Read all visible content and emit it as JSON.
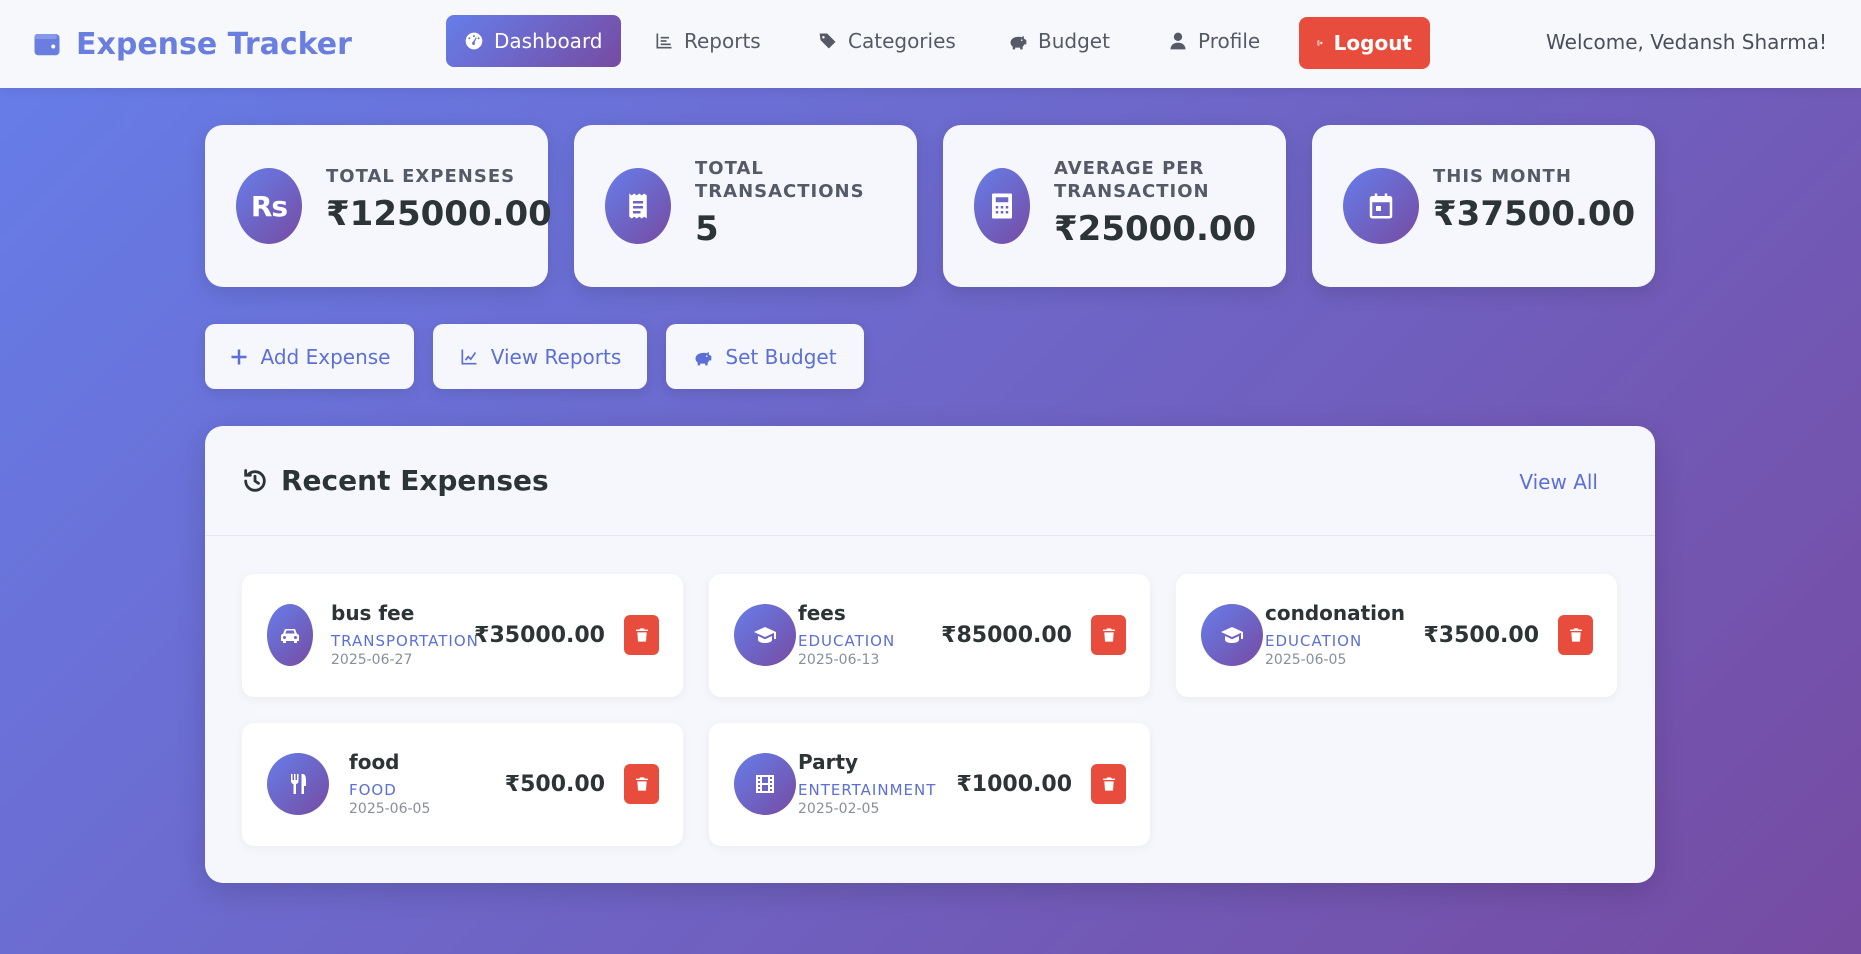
{
  "brand": {
    "title": "Expense Tracker",
    "icon": "wallet-icon"
  },
  "nav": {
    "items": [
      {
        "label": "Dashboard",
        "icon": "gauge-icon",
        "active": true
      },
      {
        "label": "Reports",
        "icon": "bar-chart-icon"
      },
      {
        "label": "Categories",
        "icon": "tags-icon"
      },
      {
        "label": "Budget",
        "icon": "piggy-bank-icon"
      },
      {
        "label": "Profile",
        "icon": "user-icon"
      },
      {
        "label": "Logout",
        "icon": "sign-out-icon"
      }
    ],
    "welcome": "Welcome, Vedansh Sharma!"
  },
  "stats": [
    {
      "label": "Total Expenses",
      "value": "₹125000.00",
      "icon": "rupee-icon"
    },
    {
      "label": "Total Transactions",
      "value": "5",
      "icon": "receipt-icon"
    },
    {
      "label": "Average per Transaction",
      "value": "₹25000.00",
      "icon": "calculator-icon"
    },
    {
      "label": "This Month",
      "value": "₹37500.00",
      "icon": "calendar-icon"
    }
  ],
  "actions": [
    {
      "label": "Add Expense",
      "icon": "plus-icon"
    },
    {
      "label": "View Reports",
      "icon": "line-chart-icon"
    },
    {
      "label": "Set Budget",
      "icon": "piggy-bank-icon"
    }
  ],
  "recent": {
    "title": "Recent Expenses",
    "view_all": "View All",
    "expenses": [
      {
        "name": "bus fee",
        "category": "Transportation",
        "date": "2025-06-27",
        "amount": "₹35000.00",
        "icon": "car-icon"
      },
      {
        "name": "fees",
        "category": "Education",
        "date": "2025-06-13",
        "amount": "₹85000.00",
        "icon": "graduation-cap-icon"
      },
      {
        "name": "condonation",
        "category": "Education",
        "date": "2025-06-05",
        "amount": "₹3500.00",
        "icon": "graduation-cap-icon"
      },
      {
        "name": "food",
        "category": "Food",
        "date": "2025-06-05",
        "amount": "₹500.00",
        "icon": "utensils-icon"
      },
      {
        "name": "Party",
        "category": "Entertainment",
        "date": "2025-02-05",
        "amount": "₹1000.00",
        "icon": "film-icon"
      }
    ]
  },
  "colors": {
    "accent_start": "#667eea",
    "accent_end": "#764ba2",
    "danger": "#e74c3c",
    "link": "#5b6fd6"
  }
}
